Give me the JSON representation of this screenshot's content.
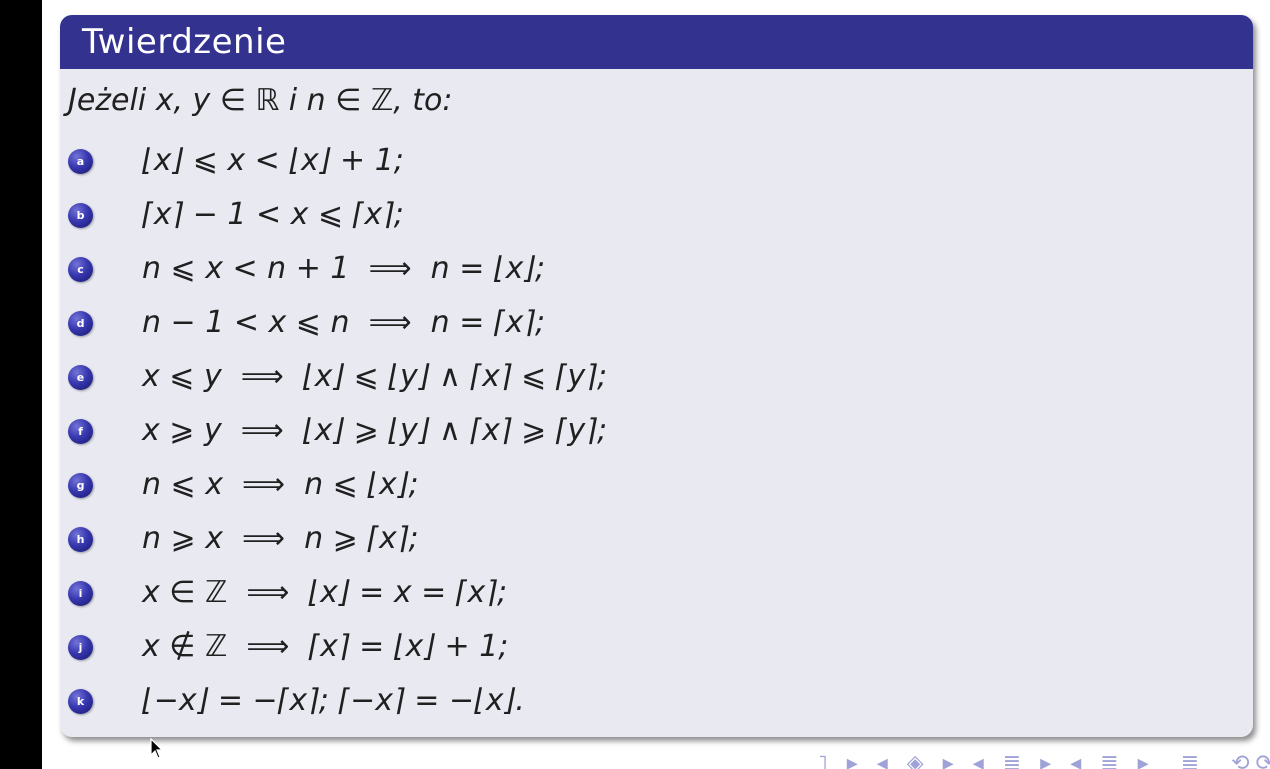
{
  "block": {
    "title": "Twierdzenie",
    "intro": "Jeżeli x, y ∈ ℝ i n ∈ ℤ, to:",
    "items": [
      {
        "letter": "a",
        "formula": "⌊x⌋ ⩽ x < ⌊x⌋ + 1;"
      },
      {
        "letter": "b",
        "formula": "⌈x⌉ − 1 < x ⩽ ⌈x⌉;"
      },
      {
        "letter": "c",
        "formula": "n ⩽ x < n + 1  ⟹  n = ⌊x⌋;"
      },
      {
        "letter": "d",
        "formula": "n − 1 < x ⩽ n  ⟹  n = ⌈x⌉;"
      },
      {
        "letter": "e",
        "formula": "x ⩽ y  ⟹  ⌊x⌋ ⩽ ⌊y⌋ ∧ ⌈x⌉ ⩽ ⌈y⌉;"
      },
      {
        "letter": "f",
        "formula": "x ⩾ y  ⟹  ⌊x⌋ ⩾ ⌊y⌋ ∧ ⌈x⌉ ⩾ ⌈y⌉;"
      },
      {
        "letter": "g",
        "formula": "n ⩽ x  ⟹  n ⩽ ⌊x⌋;"
      },
      {
        "letter": "h",
        "formula": "n ⩾ x  ⟹  n ⩾ ⌈x⌉;"
      },
      {
        "letter": "i",
        "formula": "x ∈ ℤ  ⟹  ⌊x⌋ = x = ⌈x⌉;"
      },
      {
        "letter": "j",
        "formula": "x ∉ ℤ  ⟹  ⌈x⌉ = ⌊x⌋ + 1;"
      },
      {
        "letter": "k",
        "formula": "⌊−x⌋ = −⌈x⌉; ⌈−x⌉ = −⌊x⌋."
      }
    ]
  },
  "navigation": {
    "symbols": "◂ □ ▸ ◂ ◈ ▸ ◂ ≣ ▸ ◂ ≣ ▸  ≣  ⟲⟳"
  },
  "colors": {
    "title_bar": "#33338f",
    "block_body": "#e9e9f2",
    "bullet": "#3838b0",
    "nav": "#9fa2d6"
  }
}
